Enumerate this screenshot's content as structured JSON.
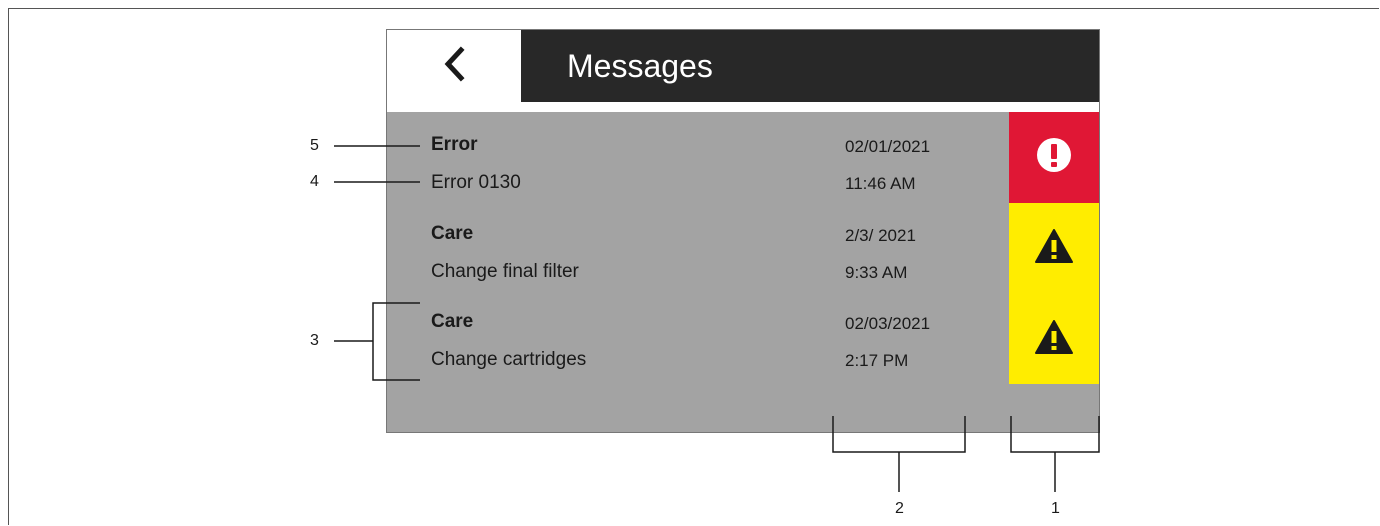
{
  "screen": {
    "title": "Messages",
    "back_icon": "chevron-left-icon"
  },
  "messages": [
    {
      "category": "Error",
      "description": "Error 0130",
      "date": "02/01/2021",
      "time": "11:46 AM",
      "status": "error",
      "status_icon": "exclamation-circle-icon",
      "status_color": "#e01735"
    },
    {
      "category": "Care",
      "description": "Change final filter",
      "date": "2/3/ 2021",
      "time": "9:33 AM",
      "status": "warning",
      "status_icon": "warning-triangle-icon",
      "status_color": "#ffed00"
    },
    {
      "category": "Care",
      "description": "Change cartridges",
      "date": "02/03/2021",
      "time": "2:17 PM",
      "status": "warning",
      "status_icon": "warning-triangle-icon",
      "status_color": "#ffed00"
    }
  ],
  "callouts": {
    "c1": "1",
    "c2": "2",
    "c3": "3",
    "c4": "4",
    "c5": "5"
  },
  "colors": {
    "title_bar": "#282828",
    "list_background": "#a3a3a3",
    "error": "#e01735",
    "warning": "#ffed00"
  }
}
